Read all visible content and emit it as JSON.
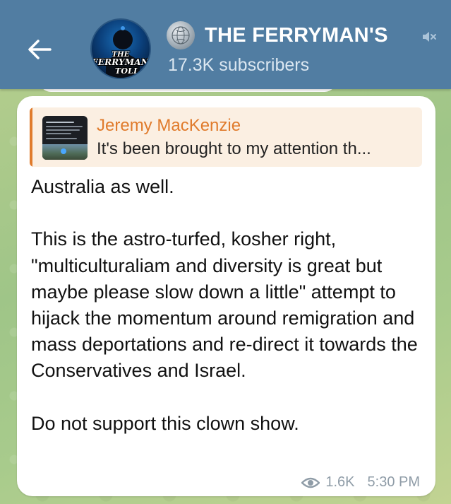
{
  "header": {
    "back_icon": "arrow-left-icon",
    "avatar_icon": "ferrymans-toll-logo",
    "avatar_text_line1": "THE",
    "avatar_text_line2": "FERRYMAN'S",
    "avatar_text_line3": "TOLL",
    "verified_icon": "globe-emblem-icon",
    "title": "THE FERRYMAN'S",
    "mute_icon": "muted-speaker-icon",
    "subscribers": "17.3K subscribers"
  },
  "message": {
    "reply": {
      "author": "Jeremy MacKenzie",
      "preview": "It's been brought to my attention th...",
      "accent_color": "#e07b2c"
    },
    "paragraphs": [
      "Australia as well.",
      "This is the astro-turfed, kosher right, \"multiculturaliam and diversity is great but maybe please slow down a little\" attempt to hijack the momentum around remigration and mass deportations and re-direct it towards the Conservatives and Israel.",
      "Do not support this clown show."
    ],
    "views_icon": "eye-icon",
    "views": "1.6K",
    "time": "5:30 PM"
  },
  "colors": {
    "header_bg": "#517da2",
    "bubble_bg": "#ffffff",
    "reply_bg": "#fbefe2",
    "meta_text": "#8f9ca7"
  }
}
